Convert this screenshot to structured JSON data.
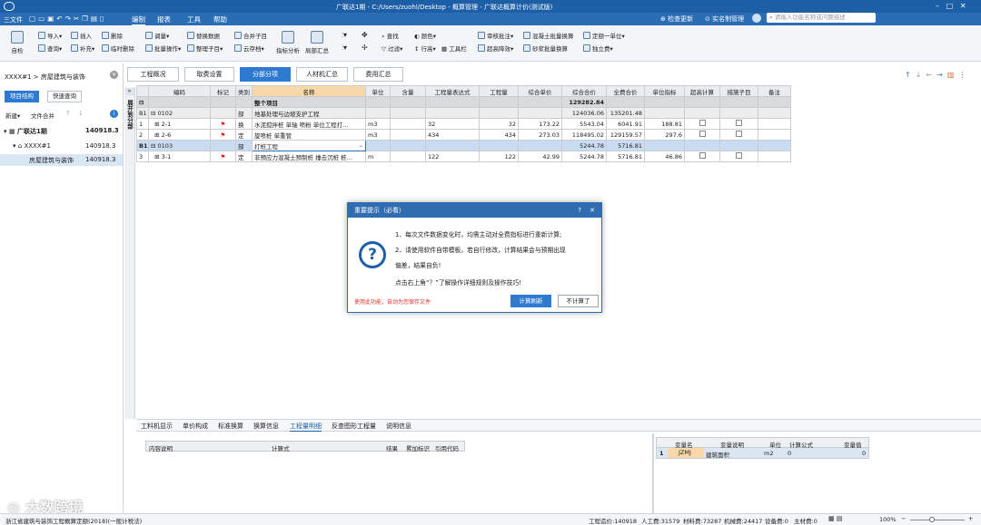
{
  "titlebar": {
    "title": "广联达1期 - C:/Users/zuohl/Desktop - 概算管理 - 广联达概算计价(测试版)",
    "file": "三文件",
    "menus": [
      "编制",
      "报表",
      "工具",
      "帮助"
    ],
    "check_update": "检查更新",
    "real_name": "实名制管理",
    "search_placeholder": "请输入功能名称或问题描述"
  },
  "ribbon": {
    "big": [
      {
        "label": "自检"
      }
    ],
    "col1": [
      "导入",
      "插入",
      "删除",
      "查询",
      "补充",
      "临时删除"
    ],
    "col2": [
      "调量",
      "替换数据",
      "合并子目",
      "批量操作",
      "整理子目",
      "云存档"
    ],
    "mid": [
      "指标分析",
      "局部汇总"
    ],
    "col3": [
      "查找",
      "颜色",
      "过滤",
      "行高",
      "工具栏"
    ],
    "col4": [
      "审核批注",
      "混凝土批量换算",
      "定额一单位",
      "超高降效",
      "砂浆批量换算",
      "独立费"
    ]
  },
  "left": {
    "breadcrumb": "XXXX#1 > 房屋建筑与装饰",
    "btn_struct": "项目结构",
    "btn_quick": "快速查询",
    "new": "新建",
    "merge": "文件合并",
    "tree": [
      {
        "name": "广联达1期",
        "value": "140918.3"
      },
      {
        "name": "XXXX#1",
        "value": "140918.3"
      },
      {
        "name": "房屋建筑与装饰",
        "value": "140918.3"
      }
    ]
  },
  "tabs": [
    "工程概况",
    "取费设置",
    "分部分项",
    "人材机汇总",
    "费用汇总"
  ],
  "side_label": "展开到分部",
  "grid": {
    "headers": [
      "",
      "编码",
      "标记",
      "类别",
      "名称",
      "单位",
      "含量",
      "工程量表达式",
      "工程量",
      "综合单价",
      "综合合价",
      "全费合价",
      "单位指标",
      "超高计算",
      "措施子目",
      "备注"
    ],
    "rows": [
      {
        "no": "",
        "code": "",
        "mark": "",
        "type": "",
        "name": "整个项目",
        "unit": "",
        "content": "",
        "expr": "",
        "qty": "",
        "price": "",
        "total": "129282.84",
        "full": "",
        "idx": ""
      },
      {
        "no": "B1",
        "code": "0102",
        "mark": "",
        "type": "部",
        "name": "地基处理与边坡支护工程",
        "unit": "",
        "content": "",
        "expr": "",
        "qty": "",
        "price": "",
        "total": "124036.06",
        "full": "135201.48",
        "idx": ""
      },
      {
        "no": "1",
        "code": "2-1",
        "mark": "flag",
        "type": "换",
        "name": "水泥搅拌桩 单轴 喷粉  单位工程打…",
        "unit": "m3",
        "content": "",
        "expr": "32",
        "qty": "32",
        "price": "173.22",
        "total": "5543.04",
        "full": "6041.91",
        "idx": "188.81"
      },
      {
        "no": "2",
        "code": "2-6",
        "mark": "flag",
        "type": "定",
        "name": "旋喷桩 单重管",
        "unit": "m3",
        "content": "",
        "expr": "434",
        "qty": "434",
        "price": "273.03",
        "total": "118495.02",
        "full": "129159.57",
        "idx": "297.6"
      },
      {
        "no": "B1",
        "code": "0103",
        "mark": "",
        "type": "部",
        "name": "打桩工程",
        "unit": "",
        "content": "",
        "expr": "",
        "qty": "",
        "price": "",
        "total": "5244.78",
        "full": "5716.81",
        "idx": ""
      },
      {
        "no": "3",
        "code": "3-1",
        "mark": "flag",
        "type": "定",
        "name": "非预应力混凝土预制桩 捶击沉桩 桩…",
        "unit": "m",
        "content": "",
        "expr": "122",
        "qty": "122",
        "price": "42.99",
        "total": "5244.78",
        "full": "5716.81",
        "idx": "46.86"
      }
    ]
  },
  "dialog": {
    "title": "重要提示（必看）",
    "line1": "1、每次文件数据变化时，均需主动对全费指标进行重新计算;",
    "line2": "2、请使用软件自带模板，若自行修改，计算结果会与预期出现",
    "line3": "偏差，结果自负!",
    "line4": "点击右上角“？”了解操作详细规则及操作技巧!",
    "note": "使用此功能，自动为您保存文件",
    "btn_calc": "计算刷新",
    "btn_skip": "不计算了"
  },
  "bottom": {
    "tabs": [
      "工料机显示",
      "单价构成",
      "标准换算",
      "换算信息",
      "工程量明细",
      "反查图形工程量",
      "说明信息"
    ],
    "left_headers": [
      "内容说明",
      "计算式",
      "结果",
      "累加标识",
      "引用代码"
    ],
    "right_headers": [
      "",
      "变量名",
      "变量说明",
      "单位",
      "计算公式",
      "变量值"
    ],
    "right_row": {
      "no": "1",
      "name": "JZMJ",
      "desc": "建筑面积",
      "unit": "m2",
      "formula": "0",
      "value": "0"
    }
  },
  "status": {
    "left": "浙江省建筑与装饰工程概算定额(2018)(一般计税法)",
    "cost": "工程造价:140918",
    "labor": "人工费:31579",
    "material": "材料费:73287",
    "machine": "机械费:24417",
    "equipment": "设备费:0",
    "main": "主材费:0",
    "zoom": "100%"
  },
  "watermark": "大数跨境"
}
